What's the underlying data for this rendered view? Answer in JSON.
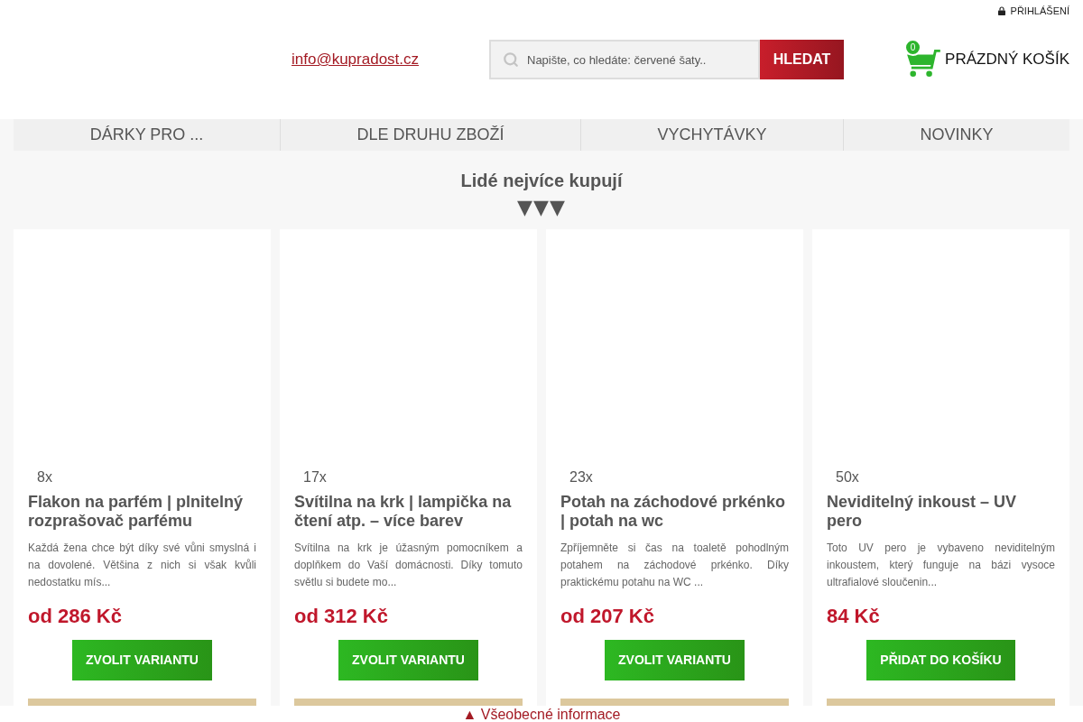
{
  "top_bar": {
    "login_link": "PŘIHLÁŠENÍ"
  },
  "header": {
    "email": "info@kupradost.cz",
    "search": {
      "placeholder": "Napište, co hledáte: červené šaty..",
      "button": "HLEDAT"
    },
    "cart": {
      "count": "0",
      "label": "PRÁZDNÝ KOŠÍK"
    }
  },
  "nav": [
    {
      "label": "DÁRKY PRO ..."
    },
    {
      "label": "DLE DRUHU ZBOŽÍ"
    },
    {
      "label": "VYCHYTÁVKY"
    },
    {
      "label": "NOVINKY"
    }
  ],
  "section": {
    "title": "Lidé nejvíce kupují",
    "arrows": "▼▼▼"
  },
  "products": [
    {
      "sold": "8x",
      "name": "Flakon na parfém | plnitelný rozprašovač parfému",
      "description": "Každá žena chce být díky své vůni smyslná i na dovolené. Většina z nich si však kvůli nedostatku mís...",
      "price": "od 286 Kč",
      "button": "ZVOLIT VARIANTU"
    },
    {
      "sold": "17x",
      "name": "Svítilna na krk | lampička na čtení atp. – více barev",
      "description": "Svítilna na krk je úžasným pomocníkem a doplňkem do Vaší domácnosti. Díky tomuto světlu si budete mo...",
      "price": "od 312 Kč",
      "button": "ZVOLIT VARIANTU"
    },
    {
      "sold": "23x",
      "name": "Potah na záchodové prkénko | potah na wc",
      "description": "Zpříjemněte si čas na toaletě pohodlným potahem na záchodové prkénko. Díky praktickému potahu na WC ...",
      "price": "od 207 Kč",
      "button": "ZVOLIT VARIANTU"
    },
    {
      "sold": "50x",
      "name": "Neviditelný inkoust – UV pero",
      "description": "Toto UV pero je vybaveno neviditelným inkoustem, který funguje na bázi vysoce ultrafialové sloučenin...",
      "price": "84 Kč",
      "button": "PŘIDAT DO KOŠÍKU"
    }
  ],
  "footer": {
    "link": "▲ Všeobecné informace"
  }
}
